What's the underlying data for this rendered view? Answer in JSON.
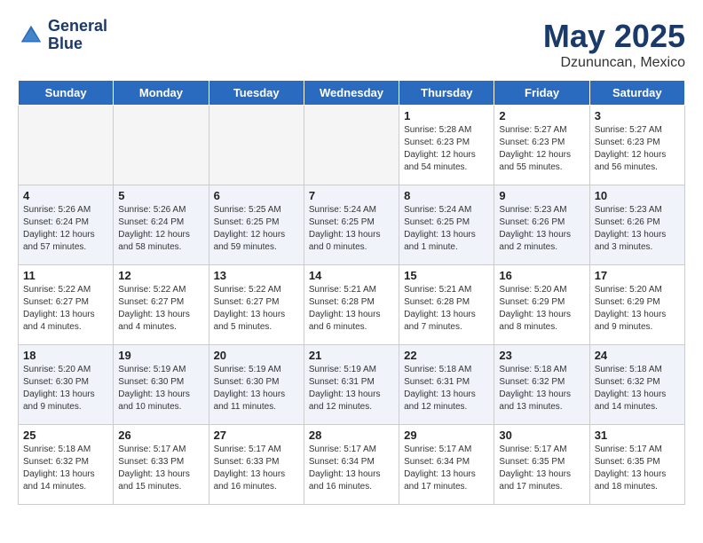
{
  "header": {
    "logo_line1": "General",
    "logo_line2": "Blue",
    "title": "May 2025",
    "subtitle": "Dzununcan, Mexico"
  },
  "weekdays": [
    "Sunday",
    "Monday",
    "Tuesday",
    "Wednesday",
    "Thursday",
    "Friday",
    "Saturday"
  ],
  "weeks": [
    [
      {
        "day": "",
        "info": ""
      },
      {
        "day": "",
        "info": ""
      },
      {
        "day": "",
        "info": ""
      },
      {
        "day": "",
        "info": ""
      },
      {
        "day": "1",
        "info": "Sunrise: 5:28 AM\nSunset: 6:23 PM\nDaylight: 12 hours\nand 54 minutes."
      },
      {
        "day": "2",
        "info": "Sunrise: 5:27 AM\nSunset: 6:23 PM\nDaylight: 12 hours\nand 55 minutes."
      },
      {
        "day": "3",
        "info": "Sunrise: 5:27 AM\nSunset: 6:23 PM\nDaylight: 12 hours\nand 56 minutes."
      }
    ],
    [
      {
        "day": "4",
        "info": "Sunrise: 5:26 AM\nSunset: 6:24 PM\nDaylight: 12 hours\nand 57 minutes."
      },
      {
        "day": "5",
        "info": "Sunrise: 5:26 AM\nSunset: 6:24 PM\nDaylight: 12 hours\nand 58 minutes."
      },
      {
        "day": "6",
        "info": "Sunrise: 5:25 AM\nSunset: 6:25 PM\nDaylight: 12 hours\nand 59 minutes."
      },
      {
        "day": "7",
        "info": "Sunrise: 5:24 AM\nSunset: 6:25 PM\nDaylight: 13 hours\nand 0 minutes."
      },
      {
        "day": "8",
        "info": "Sunrise: 5:24 AM\nSunset: 6:25 PM\nDaylight: 13 hours\nand 1 minute."
      },
      {
        "day": "9",
        "info": "Sunrise: 5:23 AM\nSunset: 6:26 PM\nDaylight: 13 hours\nand 2 minutes."
      },
      {
        "day": "10",
        "info": "Sunrise: 5:23 AM\nSunset: 6:26 PM\nDaylight: 13 hours\nand 3 minutes."
      }
    ],
    [
      {
        "day": "11",
        "info": "Sunrise: 5:22 AM\nSunset: 6:27 PM\nDaylight: 13 hours\nand 4 minutes."
      },
      {
        "day": "12",
        "info": "Sunrise: 5:22 AM\nSunset: 6:27 PM\nDaylight: 13 hours\nand 4 minutes."
      },
      {
        "day": "13",
        "info": "Sunrise: 5:22 AM\nSunset: 6:27 PM\nDaylight: 13 hours\nand 5 minutes."
      },
      {
        "day": "14",
        "info": "Sunrise: 5:21 AM\nSunset: 6:28 PM\nDaylight: 13 hours\nand 6 minutes."
      },
      {
        "day": "15",
        "info": "Sunrise: 5:21 AM\nSunset: 6:28 PM\nDaylight: 13 hours\nand 7 minutes."
      },
      {
        "day": "16",
        "info": "Sunrise: 5:20 AM\nSunset: 6:29 PM\nDaylight: 13 hours\nand 8 minutes."
      },
      {
        "day": "17",
        "info": "Sunrise: 5:20 AM\nSunset: 6:29 PM\nDaylight: 13 hours\nand 9 minutes."
      }
    ],
    [
      {
        "day": "18",
        "info": "Sunrise: 5:20 AM\nSunset: 6:30 PM\nDaylight: 13 hours\nand 9 minutes."
      },
      {
        "day": "19",
        "info": "Sunrise: 5:19 AM\nSunset: 6:30 PM\nDaylight: 13 hours\nand 10 minutes."
      },
      {
        "day": "20",
        "info": "Sunrise: 5:19 AM\nSunset: 6:30 PM\nDaylight: 13 hours\nand 11 minutes."
      },
      {
        "day": "21",
        "info": "Sunrise: 5:19 AM\nSunset: 6:31 PM\nDaylight: 13 hours\nand 12 minutes."
      },
      {
        "day": "22",
        "info": "Sunrise: 5:18 AM\nSunset: 6:31 PM\nDaylight: 13 hours\nand 12 minutes."
      },
      {
        "day": "23",
        "info": "Sunrise: 5:18 AM\nSunset: 6:32 PM\nDaylight: 13 hours\nand 13 minutes."
      },
      {
        "day": "24",
        "info": "Sunrise: 5:18 AM\nSunset: 6:32 PM\nDaylight: 13 hours\nand 14 minutes."
      }
    ],
    [
      {
        "day": "25",
        "info": "Sunrise: 5:18 AM\nSunset: 6:32 PM\nDaylight: 13 hours\nand 14 minutes."
      },
      {
        "day": "26",
        "info": "Sunrise: 5:17 AM\nSunset: 6:33 PM\nDaylight: 13 hours\nand 15 minutes."
      },
      {
        "day": "27",
        "info": "Sunrise: 5:17 AM\nSunset: 6:33 PM\nDaylight: 13 hours\nand 16 minutes."
      },
      {
        "day": "28",
        "info": "Sunrise: 5:17 AM\nSunset: 6:34 PM\nDaylight: 13 hours\nand 16 minutes."
      },
      {
        "day": "29",
        "info": "Sunrise: 5:17 AM\nSunset: 6:34 PM\nDaylight: 13 hours\nand 17 minutes."
      },
      {
        "day": "30",
        "info": "Sunrise: 5:17 AM\nSunset: 6:35 PM\nDaylight: 13 hours\nand 17 minutes."
      },
      {
        "day": "31",
        "info": "Sunrise: 5:17 AM\nSunset: 6:35 PM\nDaylight: 13 hours\nand 18 minutes."
      }
    ]
  ]
}
